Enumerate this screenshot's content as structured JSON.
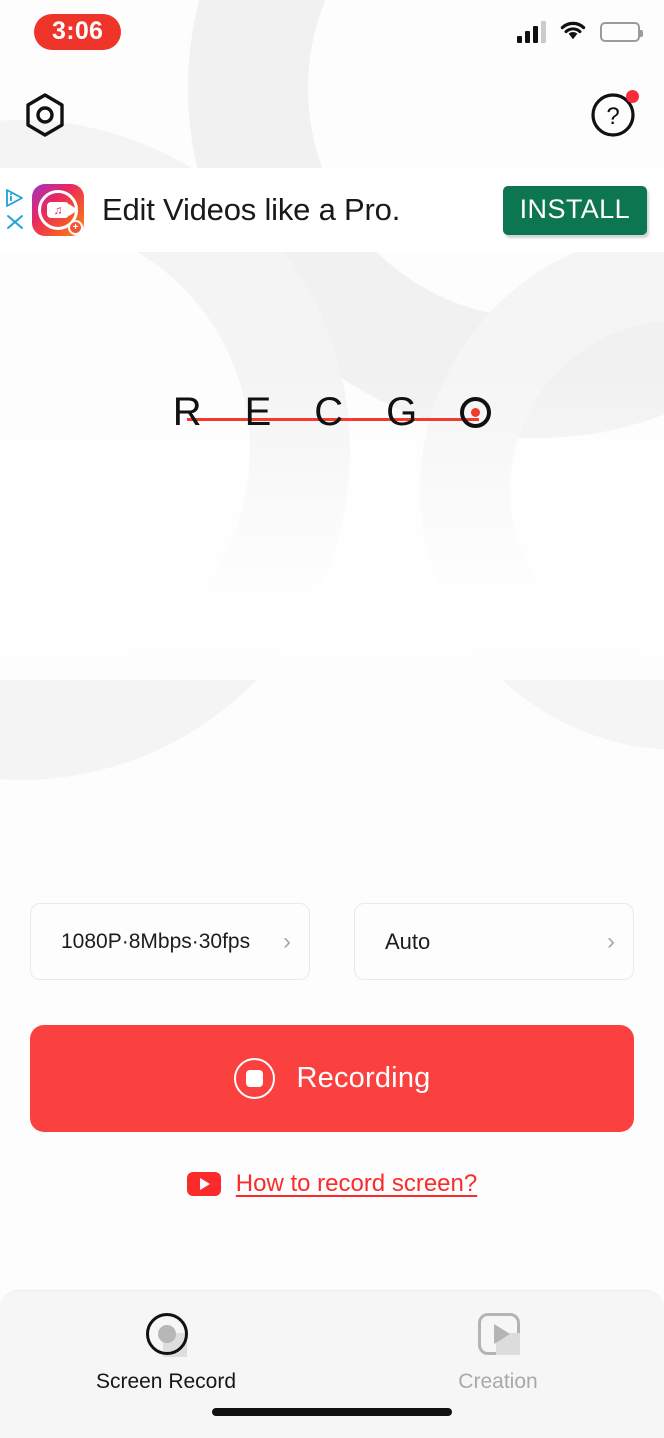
{
  "status_bar": {
    "time": "3:06",
    "time_pill_color": "#ef3429",
    "signal_icon": "cellular-signal-icon",
    "signal_bars_filled": 3,
    "signal_bars_total": 4,
    "wifi_icon": "wifi-icon",
    "battery_icon": "battery-low-icon",
    "battery_level_percent": 20
  },
  "top_nav": {
    "settings_icon": "settings-nut-icon",
    "help_icon": "help-question-icon",
    "help_badge": "notification-dot"
  },
  "ad": {
    "adchoices_icon": "adchoices-icon",
    "close_icon": "close-icon",
    "app_icon": "video-editor-app-icon",
    "headline": "Edit Videos like a Pro.",
    "cta_label": "INSTALL",
    "cta_color": "#0c7650"
  },
  "brand": {
    "letters": [
      "R",
      "E",
      "C",
      "G"
    ],
    "record_letter_icon": "record-dot-icon",
    "name": "RECGO",
    "strike_color": "#f43a2e"
  },
  "options": [
    {
      "label": "1080P·8Mbps·30fps",
      "chevron": "chevron-right-icon",
      "name": "video-quality-option"
    },
    {
      "label": "Auto",
      "chevron": "chevron-right-icon",
      "name": "orientation-option"
    }
  ],
  "record": {
    "label": "Recording",
    "icon": "stop-record-icon",
    "color": "#fb4040"
  },
  "howto": {
    "icon": "youtube-play-icon",
    "label": "How to record screen?",
    "color": "#fb2b2b"
  },
  "tabs": [
    {
      "label": "Screen Record",
      "icon": "screen-record-icon",
      "active": true
    },
    {
      "label": "Creation",
      "icon": "creation-play-icon",
      "active": false
    }
  ],
  "home_indicator": "home-indicator"
}
